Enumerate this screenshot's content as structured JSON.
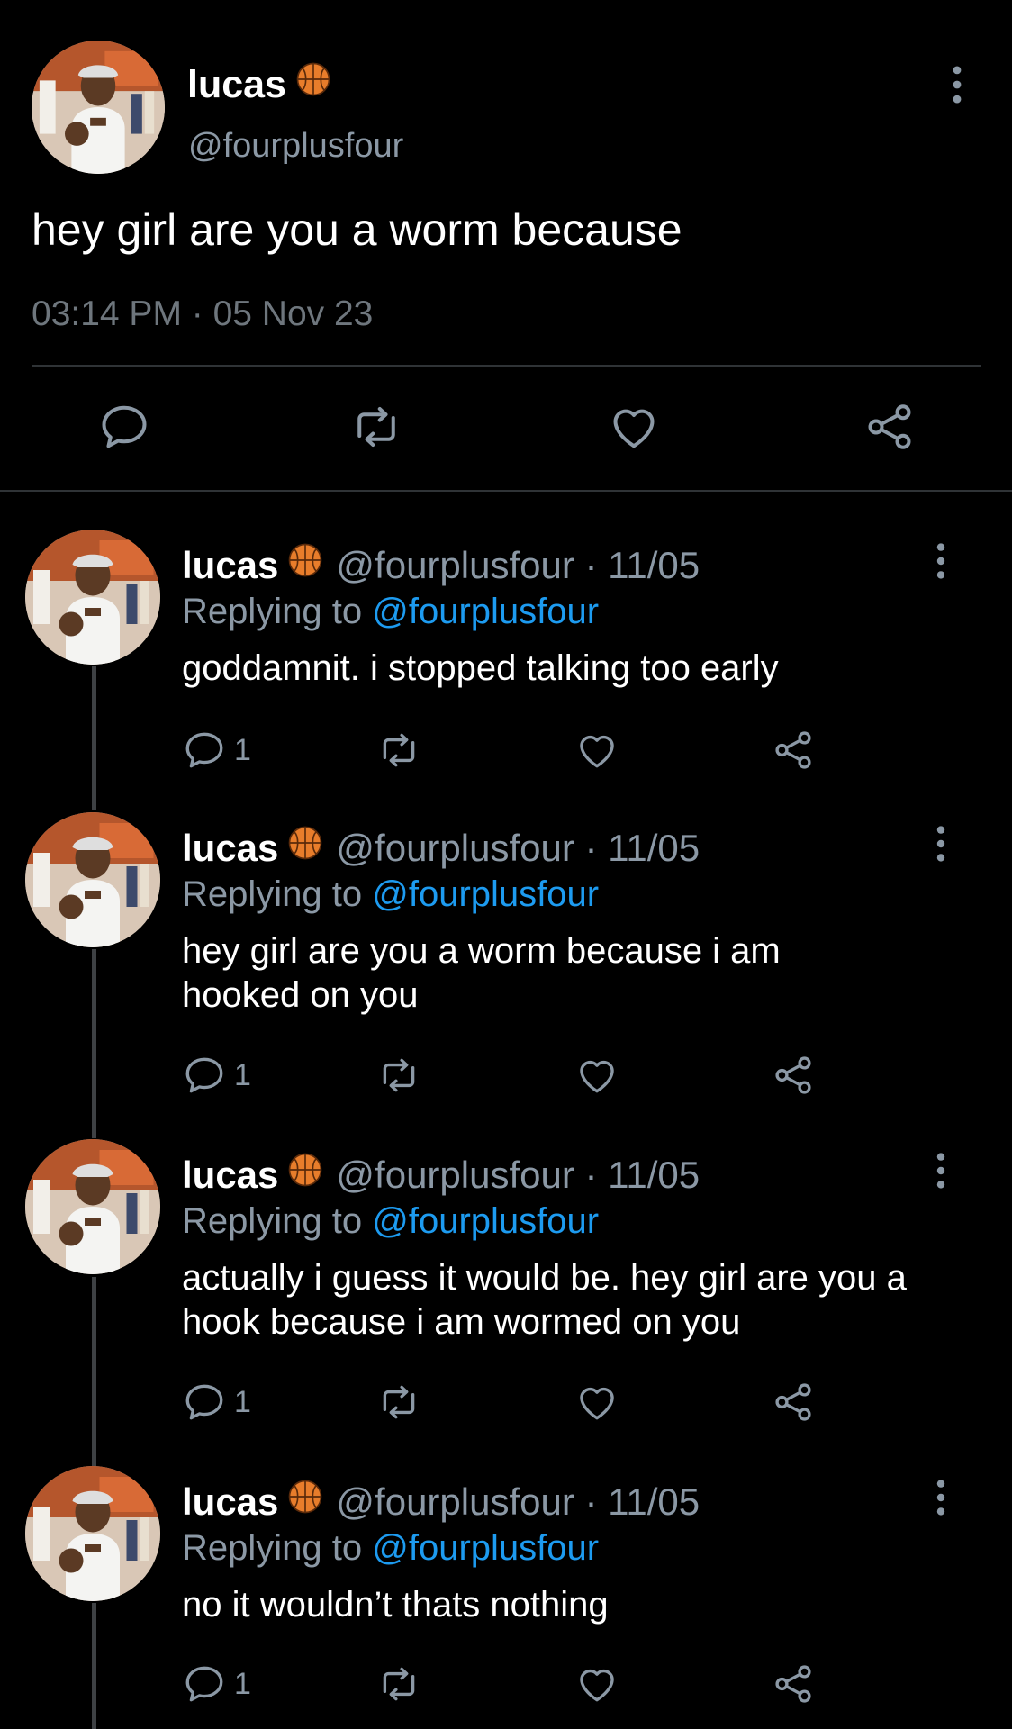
{
  "main_tweet": {
    "display_name": "lucas",
    "name_emoji": "basketball-emoji",
    "handle": "@fourplusfour",
    "text": "hey girl are you a worm because",
    "timestamp": "03:14 PM · 05 Nov 23"
  },
  "replies": [
    {
      "display_name": "lucas",
      "meta": "@fourplusfour · 11/05",
      "replying_label": "Replying to",
      "replying_to": "@fourplusfour",
      "text": "goddamnit. i stopped talking too early",
      "reply_count": "1"
    },
    {
      "display_name": "lucas",
      "meta": "@fourplusfour · 11/05",
      "replying_label": "Replying to",
      "replying_to": "@fourplusfour",
      "text": "hey girl are you a worm because i am hooked on you",
      "reply_count": "1"
    },
    {
      "display_name": "lucas",
      "meta": "@fourplusfour · 11/05",
      "replying_label": "Replying to",
      "replying_to": "@fourplusfour",
      "text": "actually i guess it would be. hey girl are you a hook because i am wormed on you",
      "reply_count": "1"
    },
    {
      "display_name": "lucas",
      "meta": "@fourplusfour · 11/05",
      "replying_label": "Replying to",
      "replying_to": "@fourplusfour",
      "text": "no it wouldn’t thats nothing",
      "reply_count": "1"
    }
  ],
  "icons": [
    "reply-icon",
    "retweet-icon",
    "like-icon",
    "share-icon",
    "more-icon",
    "basketball-emoji"
  ],
  "colors": {
    "background": "#000000",
    "text": "#ffffff",
    "secondary": "#8b98a5",
    "link": "#1d9bf0",
    "divider": "#2f3336"
  }
}
